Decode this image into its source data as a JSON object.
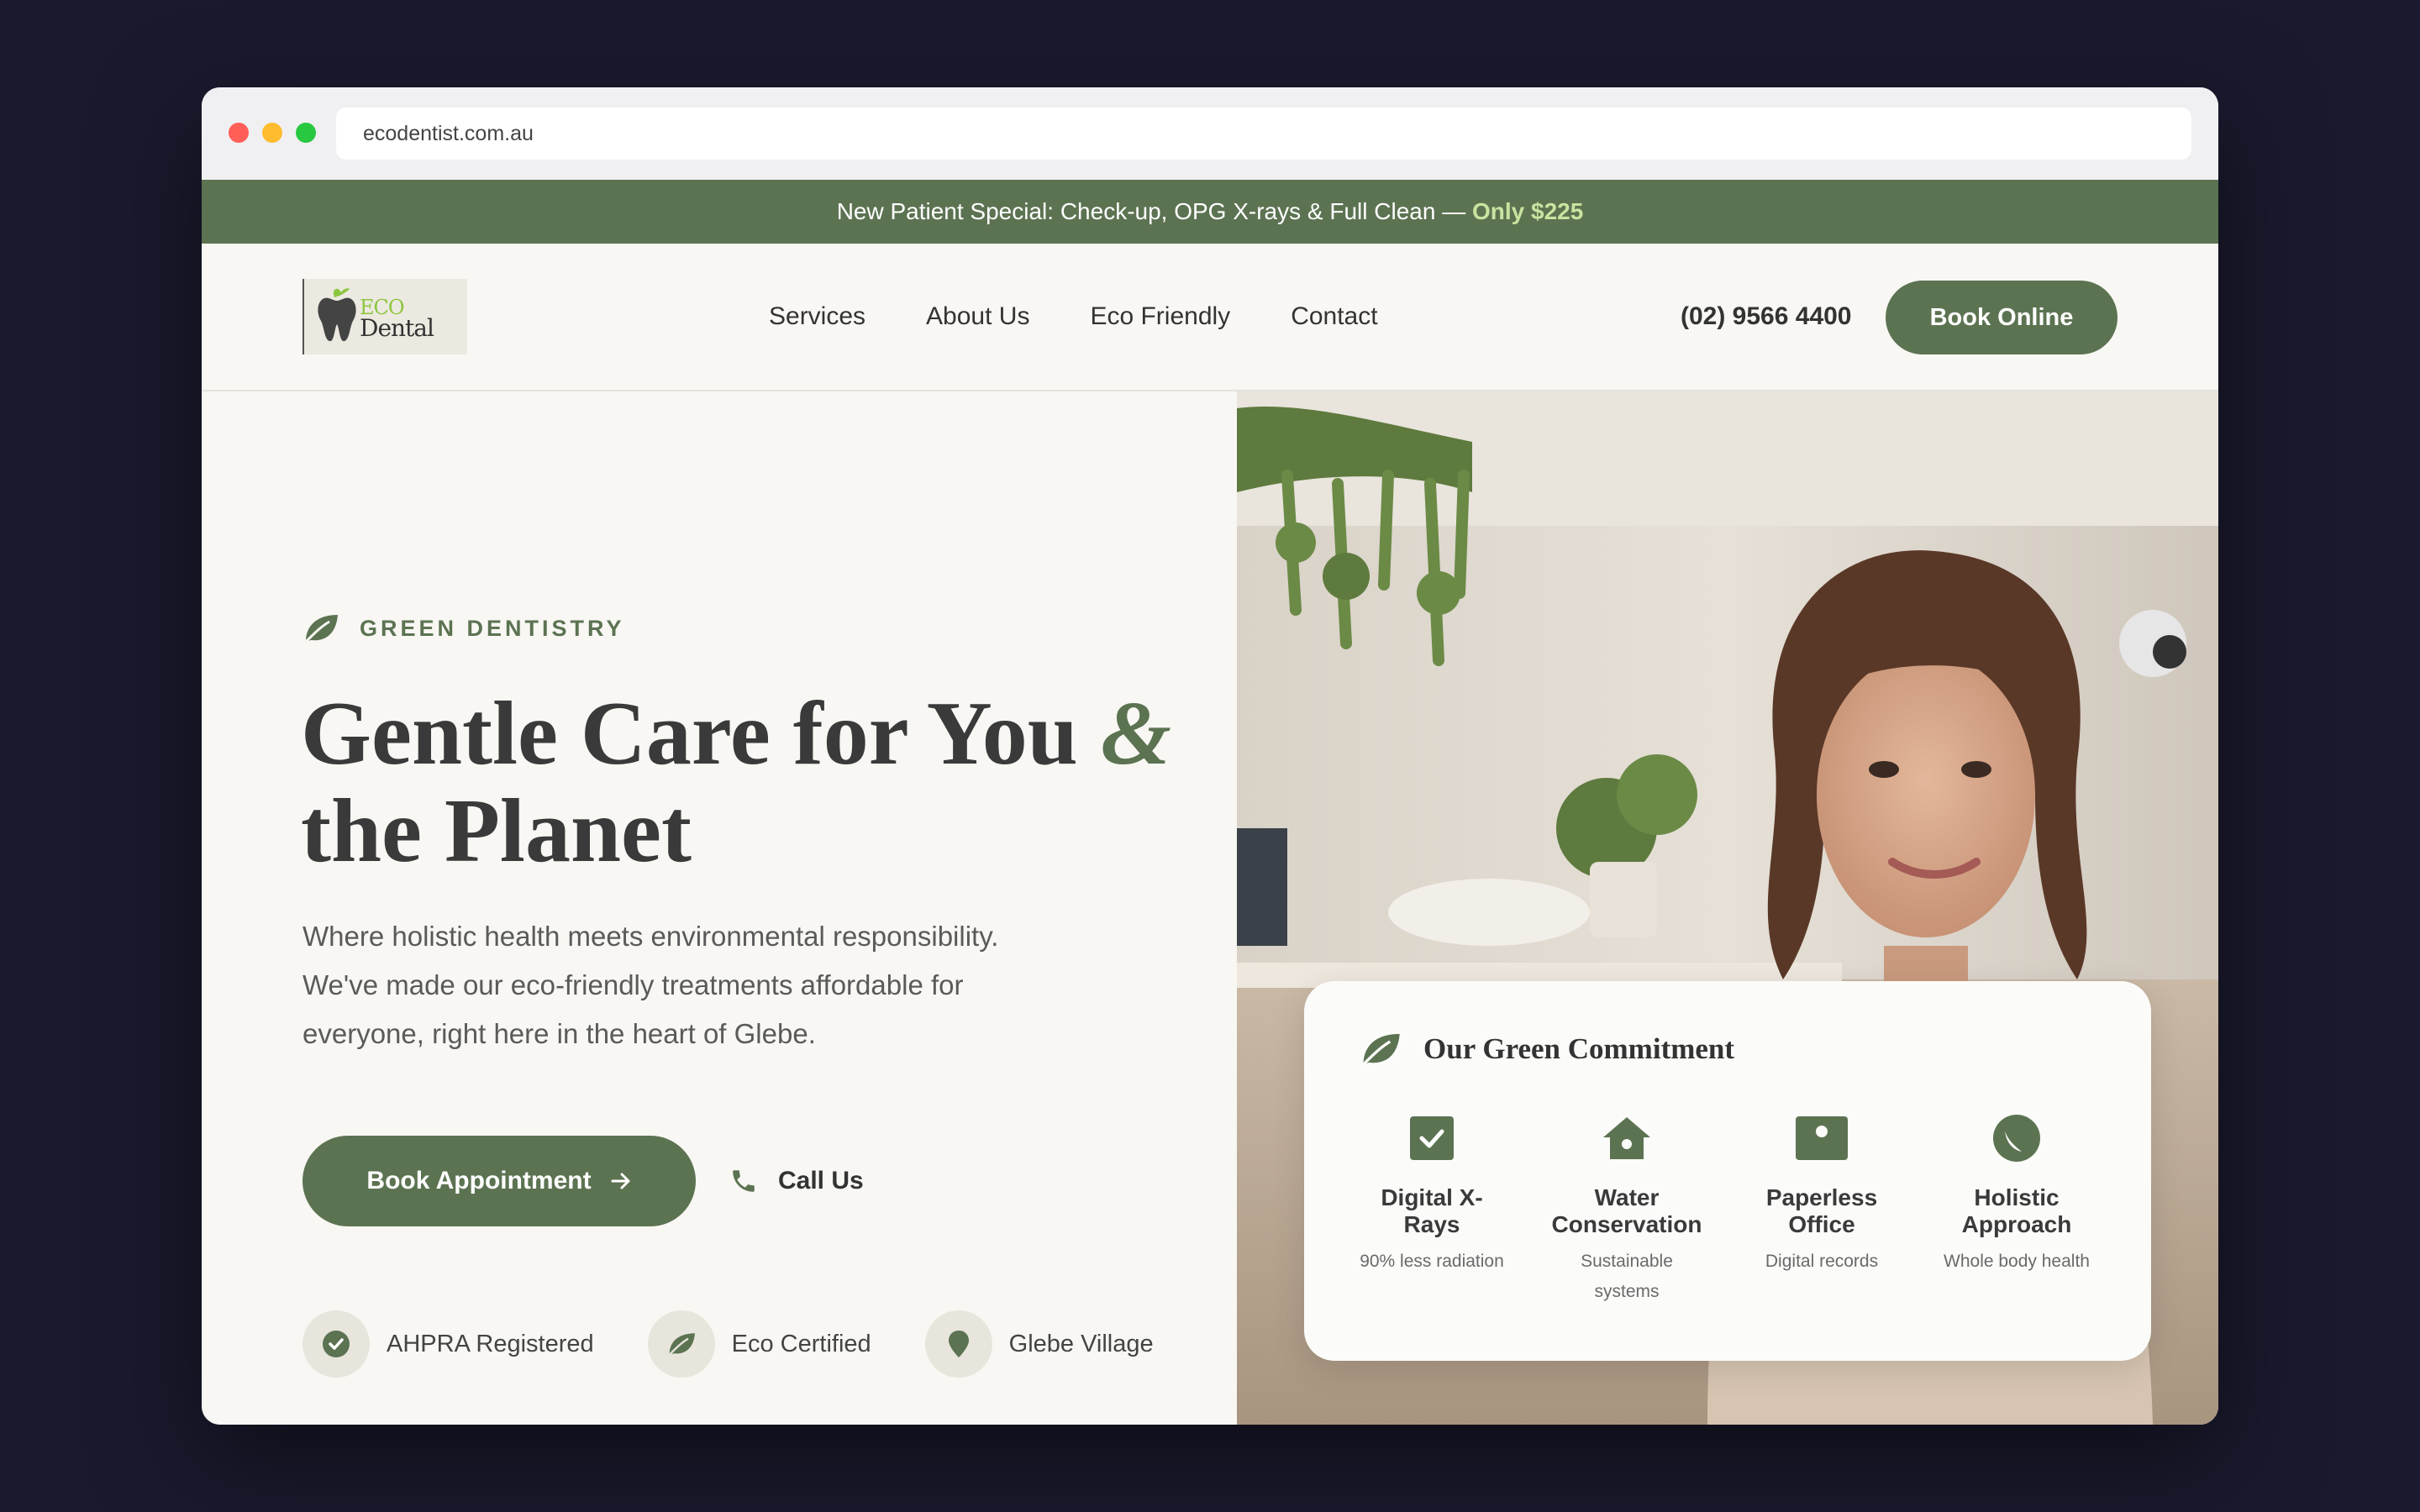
{
  "browser": {
    "url": "ecodentist.com.au"
  },
  "promo": {
    "text": "New Patient Special: Check-up, OPG X-rays & Full Clean — ",
    "highlight": "Only $225"
  },
  "logo": {
    "eco": "ECO",
    "dental": "Dental"
  },
  "nav": {
    "links": [
      "Services",
      "About Us",
      "Eco Friendly",
      "Contact"
    ],
    "phone": "(02) 9566 4400",
    "book_online": "Book Online"
  },
  "hero": {
    "tag": "GREEN DENTISTRY",
    "headline_part1": "Gentle Care for You ",
    "headline_amp": "&",
    "headline_part2": "the Planet",
    "subtext": "Where holistic health meets environmental responsibility. We've made our eco-friendly treatments affordable for everyone, right here in the heart of Glebe.",
    "book_button": "Book Appointment",
    "call_button": "Call Us",
    "badges": [
      "AHPRA Registered",
      "Eco Certified",
      "Glebe Village"
    ]
  },
  "commitment": {
    "title": "Our Green Commitment",
    "features": [
      {
        "title": "Digital X-Rays",
        "subtitle": "90% less radiation",
        "icon": "checkbox-icon"
      },
      {
        "title": "Water Conservation",
        "subtitle": "Sustainable systems",
        "icon": "home-icon"
      },
      {
        "title": "Paperless Office",
        "subtitle": "Digital records",
        "icon": "id-card-icon"
      },
      {
        "title": "Holistic Approach",
        "subtitle": "Whole body health",
        "icon": "globe-leaf-icon"
      }
    ]
  },
  "colors": {
    "primary": "#5c7352",
    "accent": "#c9e3a0",
    "background": "#f8f7f3"
  }
}
